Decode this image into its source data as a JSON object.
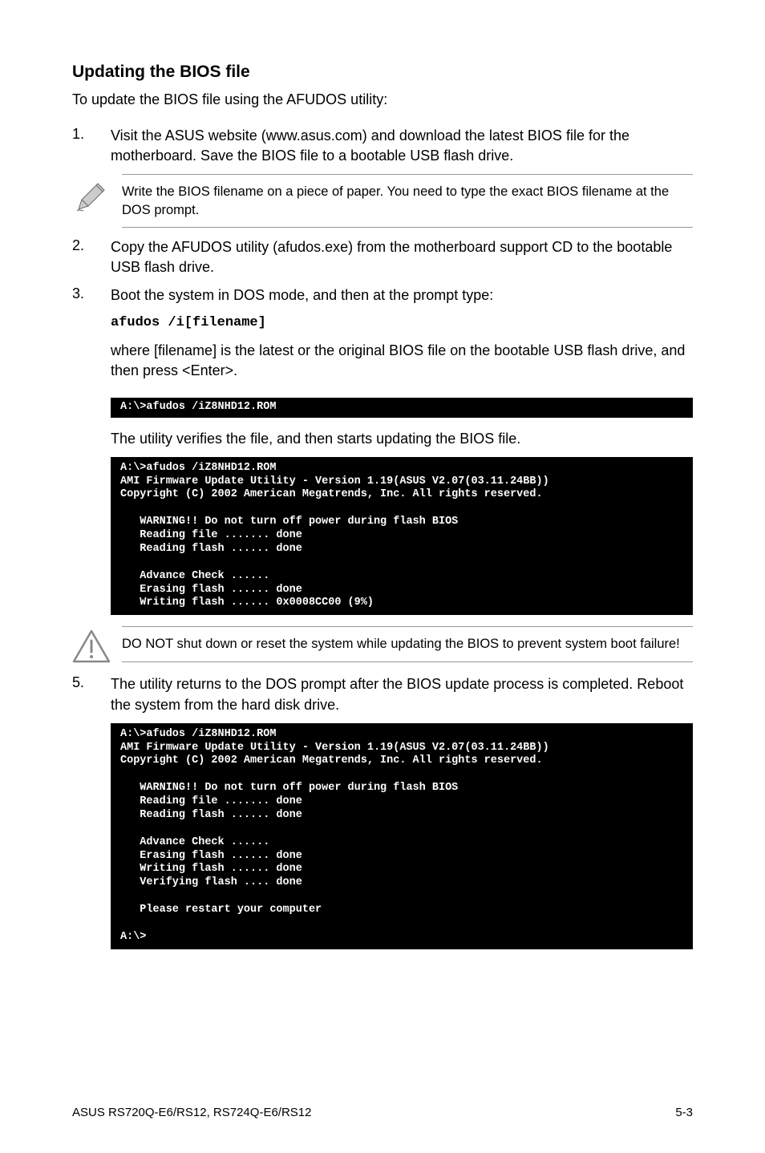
{
  "heading": "Updating the BIOS file",
  "intro": "To update the BIOS file using the AFUDOS utility:",
  "step1": {
    "num": "1.",
    "text": "Visit the ASUS website (www.asus.com) and download the latest BIOS file for the motherboard. Save the BIOS file to a bootable USB flash drive."
  },
  "note1": "Write the BIOS filename on a piece of paper. You need to type the exact BIOS filename at the DOS prompt.",
  "step2": {
    "num": "2.",
    "text": "Copy the AFUDOS utility (afudos.exe) from the motherboard support CD to the bootable USB flash drive."
  },
  "step3": {
    "num": "3.",
    "text1": "Boot the system in DOS mode, and then at the prompt type:",
    "code": "afudos /i[filename]",
    "text2": "where [filename] is the latest or the original BIOS file on the bootable USB flash drive, and then press <Enter>."
  },
  "terminal1": "A:\\>afudos /iZ8NHD12.ROM",
  "step3b": "The utility verifies the file, and then starts updating the BIOS file.",
  "terminal2": "A:\\>afudos /iZ8NHD12.ROM\nAMI Firmware Update Utility - Version 1.19(ASUS V2.07(03.11.24BB))\nCopyright (C) 2002 American Megatrends, Inc. All rights reserved.\n\n   WARNING!! Do not turn off power during flash BIOS\n   Reading file ....... done\n   Reading flash ...... done\n\n   Advance Check ......\n   Erasing flash ...... done\n   Writing flash ...... 0x0008CC00 (9%)",
  "note2": "DO NOT shut down or reset the system while updating the BIOS to prevent system boot failure!",
  "step5": {
    "num": "5.",
    "text": "The utility returns to the DOS prompt after the BIOS update process is completed. Reboot the system from the hard disk drive."
  },
  "terminal3": "A:\\>afudos /iZ8NHD12.ROM\nAMI Firmware Update Utility - Version 1.19(ASUS V2.07(03.11.24BB))\nCopyright (C) 2002 American Megatrends, Inc. All rights reserved.\n\n   WARNING!! Do not turn off power during flash BIOS\n   Reading file ....... done\n   Reading flash ...... done\n\n   Advance Check ......\n   Erasing flash ...... done\n   Writing flash ...... done\n   Verifying flash .... done\n\n   Please restart your computer\n\nA:\\>",
  "footer_left": "ASUS RS720Q-E6/RS12, RS724Q-E6/RS12",
  "footer_right": "5-3"
}
